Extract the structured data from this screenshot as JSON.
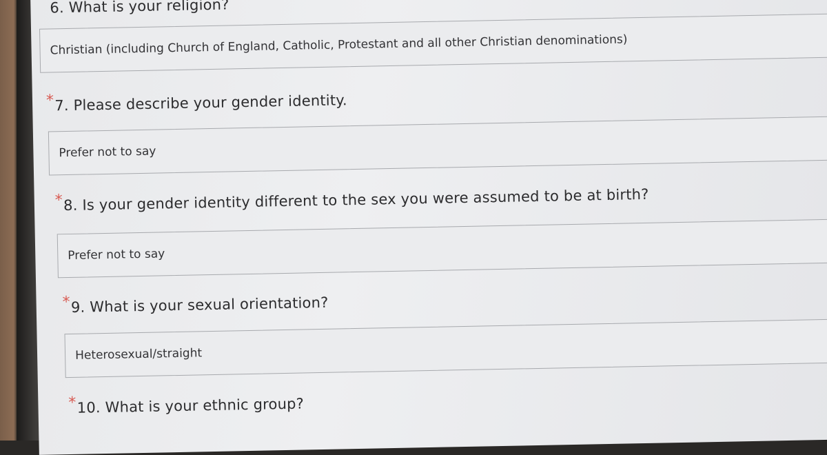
{
  "form": {
    "q6": {
      "label": "6. What is your religion?",
      "answer": "Christian (including Church of England, Catholic, Protestant and all other Christian denominations)"
    },
    "q7": {
      "required": "*",
      "label": "7. Please describe your gender identity.",
      "answer": "Prefer not to say"
    },
    "q8": {
      "required": "*",
      "label": "8. Is your gender identity different to the sex you were assumed to be at birth?",
      "answer": "Prefer not to say"
    },
    "q9": {
      "required": "*",
      "label": "9. What is your sexual orientation?",
      "answer": "Heterosexual/straight"
    },
    "q10": {
      "required": "*",
      "label": "10. What is your ethnic group?"
    }
  },
  "colors": {
    "required_star": "#d85a52",
    "screen_bg": "#e8e9eb",
    "box_border": "#a7a9ad"
  }
}
